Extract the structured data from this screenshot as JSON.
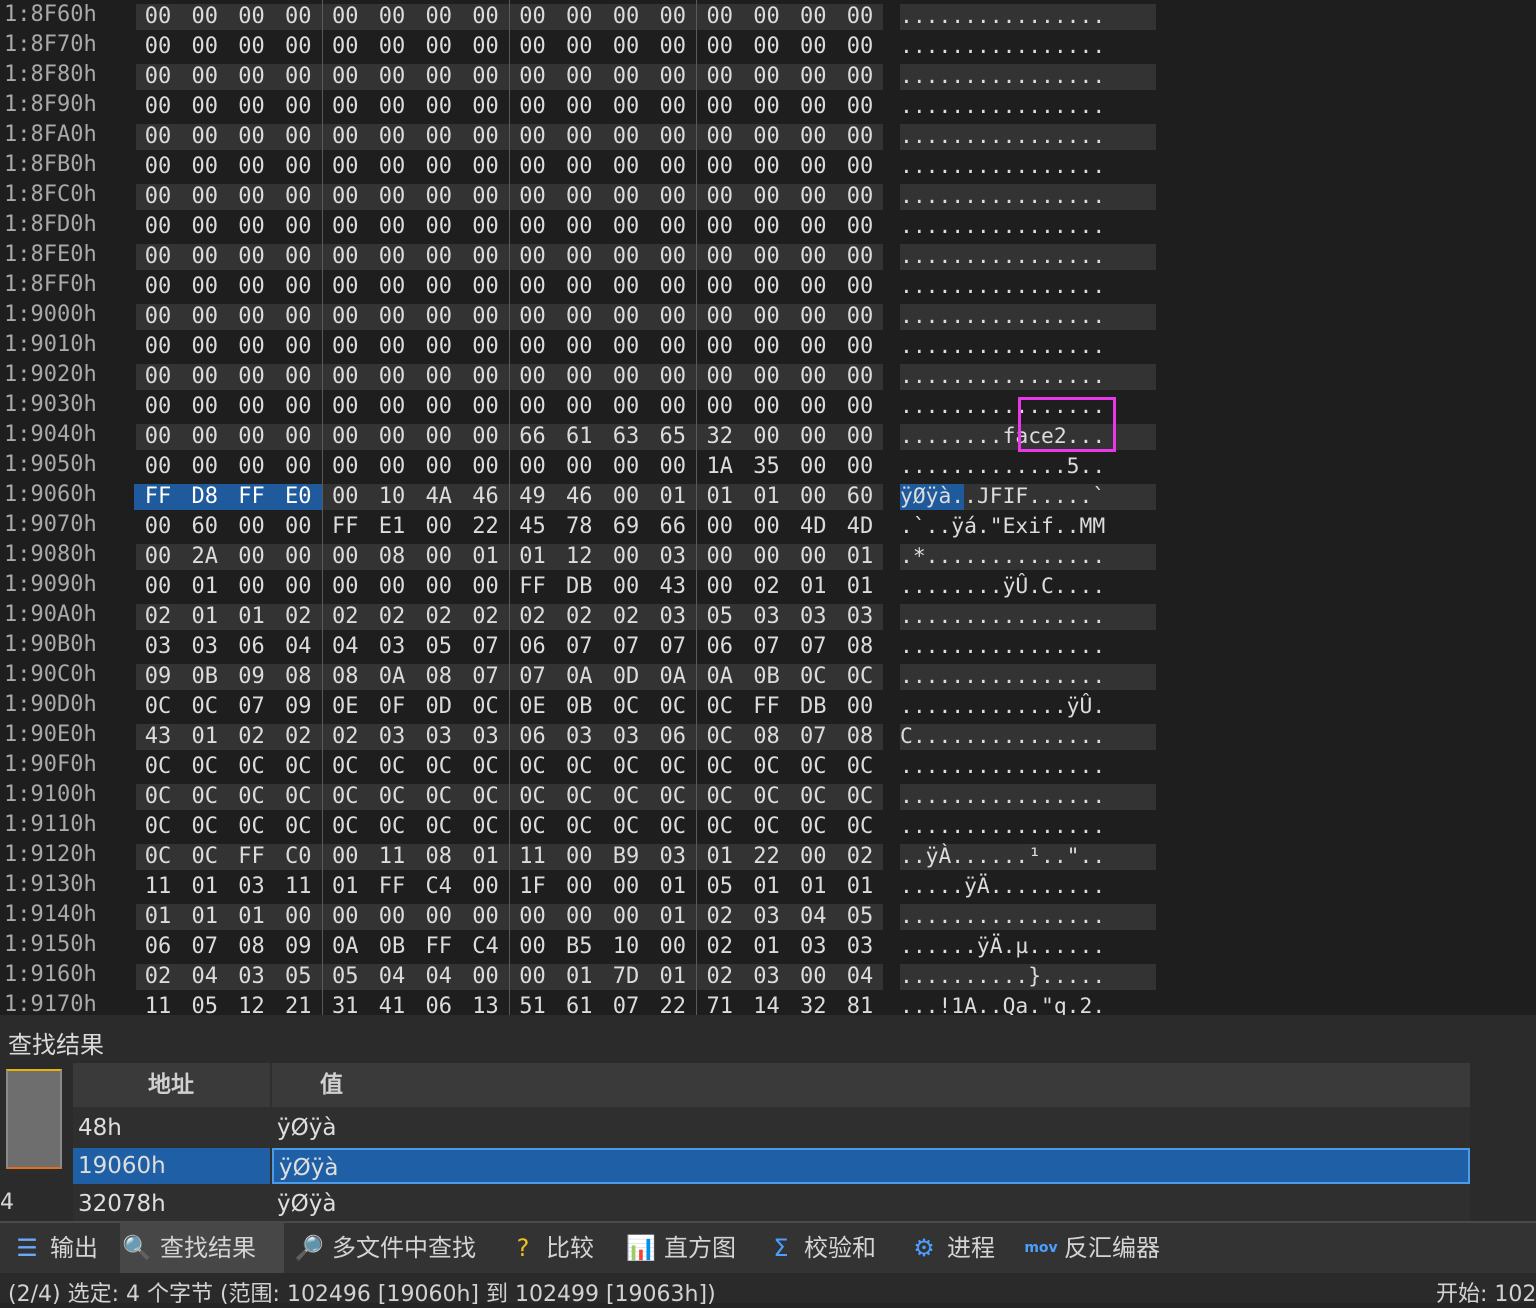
{
  "hex_rows": [
    {
      "addr": "1:8F60h",
      "bytes": [
        "00",
        "00",
        "00",
        "00",
        "00",
        "00",
        "00",
        "00",
        "00",
        "00",
        "00",
        "00",
        "00",
        "00",
        "00",
        "00"
      ],
      "ascii": "................"
    },
    {
      "addr": "1:8F70h",
      "bytes": [
        "00",
        "00",
        "00",
        "00",
        "00",
        "00",
        "00",
        "00",
        "00",
        "00",
        "00",
        "00",
        "00",
        "00",
        "00",
        "00"
      ],
      "ascii": "................"
    },
    {
      "addr": "1:8F80h",
      "bytes": [
        "00",
        "00",
        "00",
        "00",
        "00",
        "00",
        "00",
        "00",
        "00",
        "00",
        "00",
        "00",
        "00",
        "00",
        "00",
        "00"
      ],
      "ascii": "................"
    },
    {
      "addr": "1:8F90h",
      "bytes": [
        "00",
        "00",
        "00",
        "00",
        "00",
        "00",
        "00",
        "00",
        "00",
        "00",
        "00",
        "00",
        "00",
        "00",
        "00",
        "00"
      ],
      "ascii": "................"
    },
    {
      "addr": "1:8FA0h",
      "bytes": [
        "00",
        "00",
        "00",
        "00",
        "00",
        "00",
        "00",
        "00",
        "00",
        "00",
        "00",
        "00",
        "00",
        "00",
        "00",
        "00"
      ],
      "ascii": "................"
    },
    {
      "addr": "1:8FB0h",
      "bytes": [
        "00",
        "00",
        "00",
        "00",
        "00",
        "00",
        "00",
        "00",
        "00",
        "00",
        "00",
        "00",
        "00",
        "00",
        "00",
        "00"
      ],
      "ascii": "................"
    },
    {
      "addr": "1:8FC0h",
      "bytes": [
        "00",
        "00",
        "00",
        "00",
        "00",
        "00",
        "00",
        "00",
        "00",
        "00",
        "00",
        "00",
        "00",
        "00",
        "00",
        "00"
      ],
      "ascii": "................"
    },
    {
      "addr": "1:8FD0h",
      "bytes": [
        "00",
        "00",
        "00",
        "00",
        "00",
        "00",
        "00",
        "00",
        "00",
        "00",
        "00",
        "00",
        "00",
        "00",
        "00",
        "00"
      ],
      "ascii": "................"
    },
    {
      "addr": "1:8FE0h",
      "bytes": [
        "00",
        "00",
        "00",
        "00",
        "00",
        "00",
        "00",
        "00",
        "00",
        "00",
        "00",
        "00",
        "00",
        "00",
        "00",
        "00"
      ],
      "ascii": "................"
    },
    {
      "addr": "1:8FF0h",
      "bytes": [
        "00",
        "00",
        "00",
        "00",
        "00",
        "00",
        "00",
        "00",
        "00",
        "00",
        "00",
        "00",
        "00",
        "00",
        "00",
        "00"
      ],
      "ascii": "................"
    },
    {
      "addr": "1:9000h",
      "bytes": [
        "00",
        "00",
        "00",
        "00",
        "00",
        "00",
        "00",
        "00",
        "00",
        "00",
        "00",
        "00",
        "00",
        "00",
        "00",
        "00"
      ],
      "ascii": "................"
    },
    {
      "addr": "1:9010h",
      "bytes": [
        "00",
        "00",
        "00",
        "00",
        "00",
        "00",
        "00",
        "00",
        "00",
        "00",
        "00",
        "00",
        "00",
        "00",
        "00",
        "00"
      ],
      "ascii": "................"
    },
    {
      "addr": "1:9020h",
      "bytes": [
        "00",
        "00",
        "00",
        "00",
        "00",
        "00",
        "00",
        "00",
        "00",
        "00",
        "00",
        "00",
        "00",
        "00",
        "00",
        "00"
      ],
      "ascii": "................"
    },
    {
      "addr": "1:9030h",
      "bytes": [
        "00",
        "00",
        "00",
        "00",
        "00",
        "00",
        "00",
        "00",
        "00",
        "00",
        "00",
        "00",
        "00",
        "00",
        "00",
        "00"
      ],
      "ascii": "................"
    },
    {
      "addr": "1:9040h",
      "bytes": [
        "00",
        "00",
        "00",
        "00",
        "00",
        "00",
        "00",
        "00",
        "66",
        "61",
        "63",
        "65",
        "32",
        "00",
        "00",
        "00"
      ],
      "ascii": "........face2..."
    },
    {
      "addr": "1:9050h",
      "bytes": [
        "00",
        "00",
        "00",
        "00",
        "00",
        "00",
        "00",
        "00",
        "00",
        "00",
        "00",
        "00",
        "1A",
        "35",
        "00",
        "00"
      ],
      "ascii": ".............5.."
    },
    {
      "addr": "1:9060h",
      "bytes": [
        "FF",
        "D8",
        "FF",
        "E0",
        "00",
        "10",
        "4A",
        "46",
        "49",
        "46",
        "00",
        "01",
        "01",
        "01",
        "00",
        "60"
      ],
      "ascii": "ÿØÿà..JFIF.....`"
    },
    {
      "addr": "1:9070h",
      "bytes": [
        "00",
        "60",
        "00",
        "00",
        "FF",
        "E1",
        "00",
        "22",
        "45",
        "78",
        "69",
        "66",
        "00",
        "00",
        "4D",
        "4D"
      ],
      "ascii": ".`..ÿá.\"Exif..MM"
    },
    {
      "addr": "1:9080h",
      "bytes": [
        "00",
        "2A",
        "00",
        "00",
        "00",
        "08",
        "00",
        "01",
        "01",
        "12",
        "00",
        "03",
        "00",
        "00",
        "00",
        "01"
      ],
      "ascii": ".*.............."
    },
    {
      "addr": "1:9090h",
      "bytes": [
        "00",
        "01",
        "00",
        "00",
        "00",
        "00",
        "00",
        "00",
        "FF",
        "DB",
        "00",
        "43",
        "00",
        "02",
        "01",
        "01"
      ],
      "ascii": "........ÿÛ.C...."
    },
    {
      "addr": "1:90A0h",
      "bytes": [
        "02",
        "01",
        "01",
        "02",
        "02",
        "02",
        "02",
        "02",
        "02",
        "02",
        "02",
        "03",
        "05",
        "03",
        "03",
        "03"
      ],
      "ascii": "................"
    },
    {
      "addr": "1:90B0h",
      "bytes": [
        "03",
        "03",
        "06",
        "04",
        "04",
        "03",
        "05",
        "07",
        "06",
        "07",
        "07",
        "07",
        "06",
        "07",
        "07",
        "08"
      ],
      "ascii": "................"
    },
    {
      "addr": "1:90C0h",
      "bytes": [
        "09",
        "0B",
        "09",
        "08",
        "08",
        "0A",
        "08",
        "07",
        "07",
        "0A",
        "0D",
        "0A",
        "0A",
        "0B",
        "0C",
        "0C"
      ],
      "ascii": "................"
    },
    {
      "addr": "1:90D0h",
      "bytes": [
        "0C",
        "0C",
        "07",
        "09",
        "0E",
        "0F",
        "0D",
        "0C",
        "0E",
        "0B",
        "0C",
        "0C",
        "0C",
        "FF",
        "DB",
        "00"
      ],
      "ascii": ".............ÿÛ."
    },
    {
      "addr": "1:90E0h",
      "bytes": [
        "43",
        "01",
        "02",
        "02",
        "02",
        "03",
        "03",
        "03",
        "06",
        "03",
        "03",
        "06",
        "0C",
        "08",
        "07",
        "08"
      ],
      "ascii": "C..............."
    },
    {
      "addr": "1:90F0h",
      "bytes": [
        "0C",
        "0C",
        "0C",
        "0C",
        "0C",
        "0C",
        "0C",
        "0C",
        "0C",
        "0C",
        "0C",
        "0C",
        "0C",
        "0C",
        "0C",
        "0C"
      ],
      "ascii": "................"
    },
    {
      "addr": "1:9100h",
      "bytes": [
        "0C",
        "0C",
        "0C",
        "0C",
        "0C",
        "0C",
        "0C",
        "0C",
        "0C",
        "0C",
        "0C",
        "0C",
        "0C",
        "0C",
        "0C",
        "0C"
      ],
      "ascii": "................"
    },
    {
      "addr": "1:9110h",
      "bytes": [
        "0C",
        "0C",
        "0C",
        "0C",
        "0C",
        "0C",
        "0C",
        "0C",
        "0C",
        "0C",
        "0C",
        "0C",
        "0C",
        "0C",
        "0C",
        "0C"
      ],
      "ascii": "................"
    },
    {
      "addr": "1:9120h",
      "bytes": [
        "0C",
        "0C",
        "FF",
        "C0",
        "00",
        "11",
        "08",
        "01",
        "11",
        "00",
        "B9",
        "03",
        "01",
        "22",
        "00",
        "02"
      ],
      "ascii": "..ÿÀ......¹..\".."
    },
    {
      "addr": "1:9130h",
      "bytes": [
        "11",
        "01",
        "03",
        "11",
        "01",
        "FF",
        "C4",
        "00",
        "1F",
        "00",
        "00",
        "01",
        "05",
        "01",
        "01",
        "01"
      ],
      "ascii": ".....ÿÄ........."
    },
    {
      "addr": "1:9140h",
      "bytes": [
        "01",
        "01",
        "01",
        "00",
        "00",
        "00",
        "00",
        "00",
        "00",
        "00",
        "00",
        "01",
        "02",
        "03",
        "04",
        "05"
      ],
      "ascii": "................"
    },
    {
      "addr": "1:9150h",
      "bytes": [
        "06",
        "07",
        "08",
        "09",
        "0A",
        "0B",
        "FF",
        "C4",
        "00",
        "B5",
        "10",
        "00",
        "02",
        "01",
        "03",
        "03"
      ],
      "ascii": "......ÿÄ.µ......"
    },
    {
      "addr": "1:9160h",
      "bytes": [
        "02",
        "04",
        "03",
        "05",
        "05",
        "04",
        "04",
        "00",
        "00",
        "01",
        "7D",
        "01",
        "02",
        "03",
        "00",
        "04"
      ],
      "ascii": "..........}....."
    },
    {
      "addr": "1:9170h",
      "bytes": [
        "11",
        "05",
        "12",
        "21",
        "31",
        "41",
        "06",
        "13",
        "51",
        "61",
        "07",
        "22",
        "71",
        "14",
        "32",
        "81"
      ],
      "ascii": "...!1A..Qa.\"q.2."
    }
  ],
  "find_panel": {
    "title": "查找结果",
    "count": "4",
    "col_address": "地址",
    "col_value": "值",
    "rows": [
      {
        "address": "48h",
        "value": "ÿØÿà"
      },
      {
        "address": "19060h",
        "value": "ÿØÿà"
      },
      {
        "address": "32078h",
        "value": "ÿØÿà"
      }
    ]
  },
  "tabs": [
    {
      "label": "输出",
      "icon": "☰"
    },
    {
      "label": "查找结果",
      "icon": "🔍"
    },
    {
      "label": "多文件中查找",
      "icon": "🔎"
    },
    {
      "label": "比较",
      "icon": "?"
    },
    {
      "label": "直方图",
      "icon": "📊"
    },
    {
      "label": "校验和",
      "icon": "Σ"
    },
    {
      "label": "进程",
      "icon": "⚙"
    },
    {
      "label": "反汇编器",
      "icon": "mov"
    }
  ],
  "status": {
    "left": "(2/4) 选定: 4 个字节 (范围: 102496 [19060h] 到 102499 [19063h])",
    "right": "开始: 102"
  },
  "colors": {
    "selection": "#1e5a9c",
    "annotation": "#e838e8",
    "background": "#1e1e1e"
  }
}
